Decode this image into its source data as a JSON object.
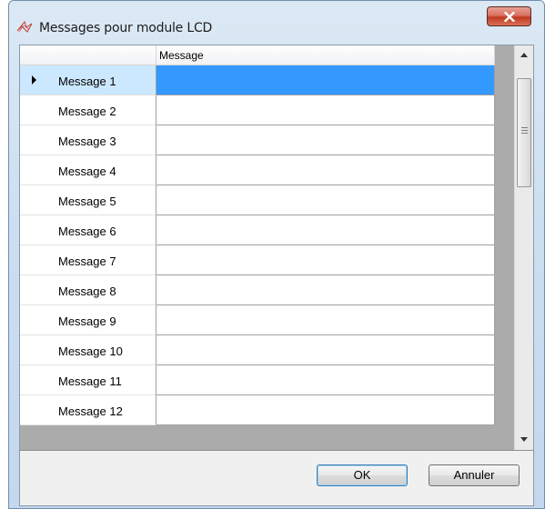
{
  "window": {
    "title": "Messages pour module LCD",
    "icon": "star-outline-icon",
    "close_icon": "close-x-icon"
  },
  "grid": {
    "column_header": "Message",
    "selected_row": 0,
    "rows": [
      {
        "label": "Message 1",
        "value": ""
      },
      {
        "label": "Message 2",
        "value": ""
      },
      {
        "label": "Message 3",
        "value": ""
      },
      {
        "label": "Message 4",
        "value": ""
      },
      {
        "label": "Message 5",
        "value": ""
      },
      {
        "label": "Message 6",
        "value": ""
      },
      {
        "label": "Message 7",
        "value": ""
      },
      {
        "label": "Message 8",
        "value": ""
      },
      {
        "label": "Message 9",
        "value": ""
      },
      {
        "label": "Message 10",
        "value": ""
      },
      {
        "label": "Message 11",
        "value": ""
      },
      {
        "label": "Message 12",
        "value": ""
      }
    ]
  },
  "buttons": {
    "ok": "OK",
    "cancel": "Annuler"
  },
  "colors": {
    "selection": "#3399ff",
    "selected_row_header": "#cce8ff",
    "close_button": "#c0391f"
  }
}
